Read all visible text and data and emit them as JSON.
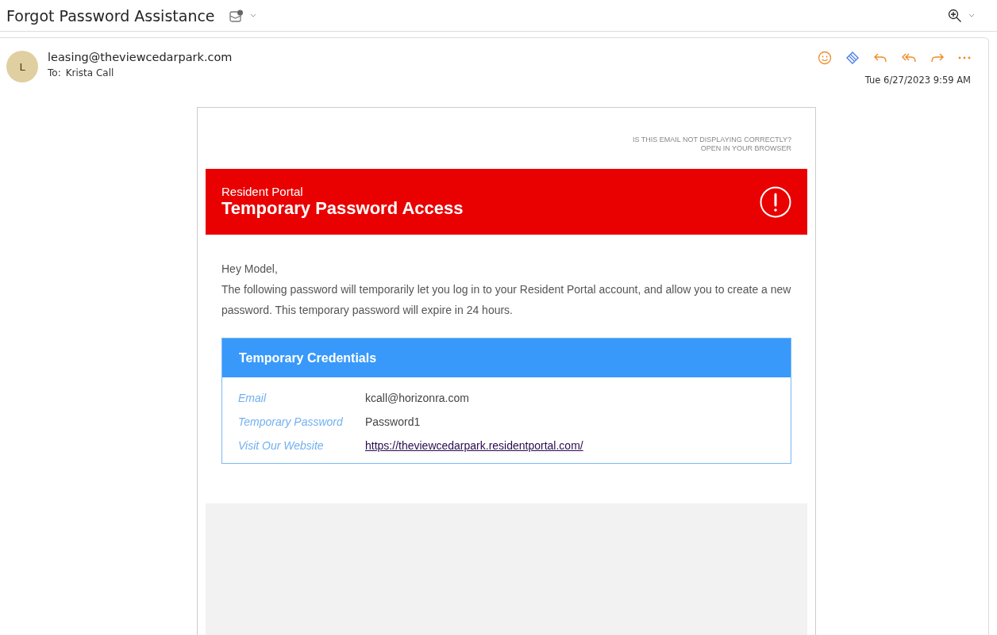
{
  "subject": "Forgot Password Assistance",
  "sender": {
    "initial": "L",
    "address": "leasing@theviewcedarpark.com",
    "to_label": "To:",
    "to": "Krista Call",
    "date": "Tue 6/27/2023 9:59 AM"
  },
  "email": {
    "notice": [
      "IS THIS EMAIL NOT DISPLAYING CORRECTLY?",
      "OPEN IN YOUR BROWSER"
    ],
    "banner": {
      "subtitle": "Resident Portal",
      "title": "Temporary Password Access"
    },
    "greeting": "Hey Model,",
    "body": "The following password will temporarily let you log in to your Resident Portal account, and allow you to create a new password. This temporary password will expire in 24 hours.",
    "credentials": {
      "title": "Temporary Credentials",
      "rows": [
        {
          "label": "Email",
          "value": "kcall@horizonra.com",
          "kind": "text"
        },
        {
          "label": "Temporary Password",
          "value": "Password1",
          "kind": "text"
        },
        {
          "label": "Visit Our Website",
          "value": "https://theviewcedarpark.residentportal.com/",
          "kind": "link"
        }
      ]
    }
  }
}
